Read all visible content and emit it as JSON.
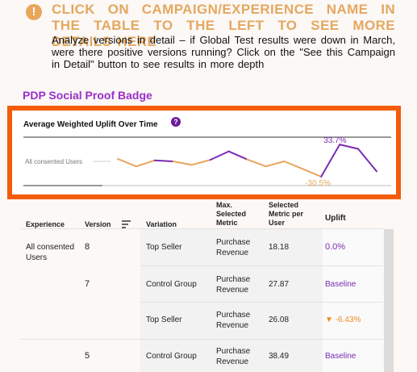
{
  "notice": {
    "icon": "exclamation-icon",
    "heading": "CLICK ON CAMPAIGN/EXPERIENCE NAME IN THE TABLE TO THE LEFT TO SEE MORE DETAILS HERE",
    "body": "Analyze versions in detail – if Global Test results were down in March, were there positive versions running? Click on the \"See this Campaign in Detail\" button to see results in more depth"
  },
  "section_title": "PDP Social Proof Badge",
  "chart": {
    "title": "Average Weighted Uplift Over Time",
    "help_icon": "?",
    "row_label": "All consented Users"
  },
  "chart_data": {
    "type": "line",
    "series": [
      {
        "values": [
          5,
          -10,
          2,
          0,
          -7,
          3,
          20,
          4,
          -10,
          0,
          -15,
          -30.5,
          33.7,
          25,
          -20
        ]
      }
    ],
    "annotations": [
      "33.7%",
      "-30.5%"
    ],
    "colors": {
      "positive": "#7b2bb5",
      "negative": "#e8a65a"
    }
  },
  "table": {
    "headers": {
      "experience": "Experience",
      "version": "Version",
      "variation": "Variation",
      "max_metric": "Max. Selected Metric",
      "selected_metric": "Selected Metric per User",
      "uplift": "Uplift"
    },
    "rows": [
      {
        "experience": "All consented Users",
        "version": "8",
        "variation": "Top Seller",
        "metric": "Purchase Revenue",
        "value": "18.18",
        "uplift": "0.0%",
        "uplift_style": "purple"
      },
      {
        "experience": "",
        "version": "7",
        "variation": "Control Group",
        "metric": "Purchase Revenue",
        "value": "27.87",
        "uplift": "Baseline",
        "uplift_style": "purple"
      },
      {
        "experience": "",
        "version": "",
        "variation": "Top Seller",
        "metric": "Purchase Revenue",
        "value": "26.08",
        "uplift": "▼ -6.43%",
        "uplift_style": "orange"
      },
      {
        "experience": "",
        "version": "5",
        "variation": "Control Group",
        "metric": "Purchase Revenue",
        "value": "38.49",
        "uplift": "Baseline",
        "uplift_style": "purple"
      }
    ]
  }
}
